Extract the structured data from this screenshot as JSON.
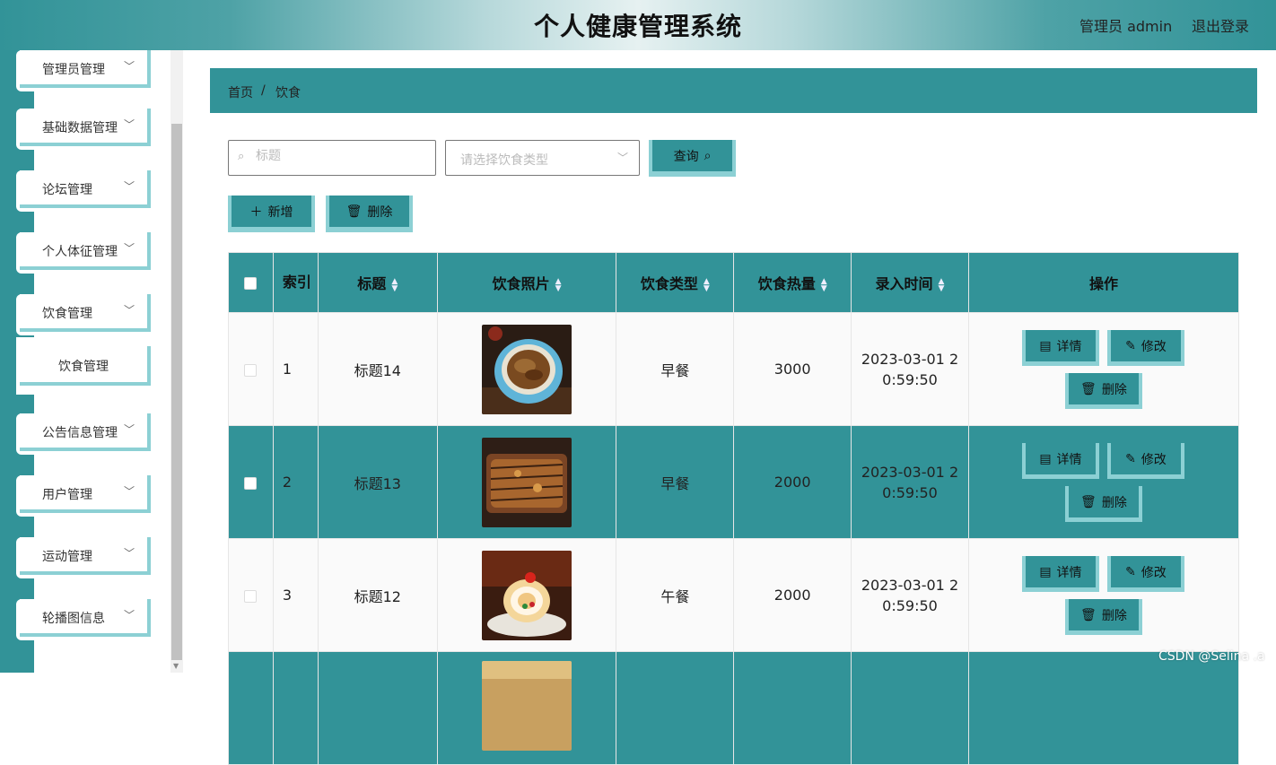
{
  "header": {
    "title": "个人健康管理系统",
    "user": "管理员 admin",
    "logout": "退出登录"
  },
  "sidebar": {
    "items": [
      {
        "label": "管理员管理"
      },
      {
        "label": "基础数据管理"
      },
      {
        "label": "论坛管理"
      },
      {
        "label": "个人体征管理"
      },
      {
        "label": "饮食管理"
      },
      {
        "label": "公告信息管理"
      },
      {
        "label": "用户管理"
      },
      {
        "label": "运动管理"
      },
      {
        "label": "轮播图信息"
      }
    ],
    "submenu": {
      "label": "饮食管理"
    }
  },
  "breadcrumb": {
    "home": "首页",
    "sep": "/",
    "current": "饮食"
  },
  "search": {
    "title_placeholder": "标题",
    "type_placeholder": "请选择饮食类型",
    "query_label": "查询"
  },
  "actions": {
    "add_label": "新增",
    "delete_label": "删除"
  },
  "table": {
    "headers": {
      "index": "索引",
      "title": "标题",
      "photo": "饮食照片",
      "type": "饮食类型",
      "calories": "饮食热量",
      "time": "录入时间",
      "ops": "操作"
    },
    "op_labels": {
      "detail": "详情",
      "edit": "修改",
      "delete": "删除"
    },
    "rows": [
      {
        "index": "1",
        "title": "标题14",
        "type": "早餐",
        "calories": "3000",
        "time1": "2023-03-01 2",
        "time2": "0:59:50",
        "photo": "noodles-bowl"
      },
      {
        "index": "2",
        "title": "标题13",
        "type": "早餐",
        "calories": "2000",
        "time1": "2023-03-01 2",
        "time2": "0:59:50",
        "photo": "grilled-meat"
      },
      {
        "index": "3",
        "title": "标题12",
        "type": "午餐",
        "calories": "2000",
        "time1": "2023-03-01 2",
        "time2": "0:59:50",
        "photo": "swiss-roll-cake"
      }
    ]
  },
  "colors": {
    "teal": "#329398",
    "light_teal": "#8cd0d4"
  },
  "watermark": "CSDN @Selina .a"
}
